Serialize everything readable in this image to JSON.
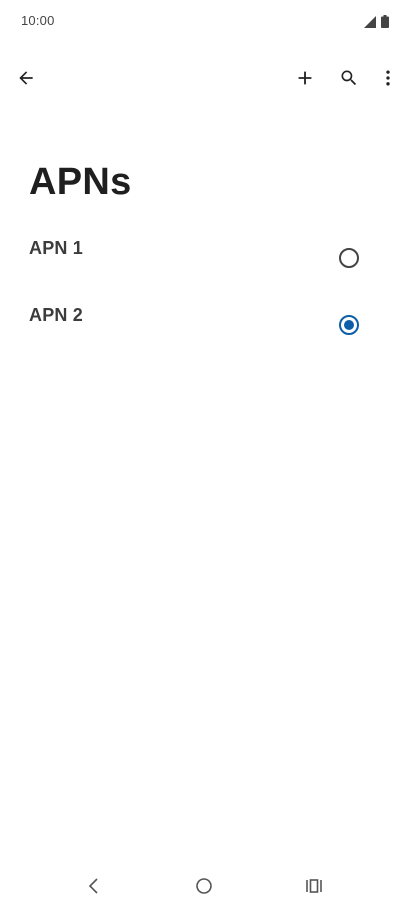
{
  "status_bar": {
    "time": "10:00",
    "icons": [
      "signal-icon",
      "battery-icon"
    ]
  },
  "app_bar": {
    "actions": [
      "back-arrow-icon",
      "add-icon",
      "search-icon",
      "more-vert-icon"
    ]
  },
  "page": {
    "title": "APNs"
  },
  "apns": [
    {
      "label": "APN 1",
      "selected": false
    },
    {
      "label": "APN 2",
      "selected": true
    }
  ],
  "nav_bar": {
    "buttons": [
      "nav-back-icon",
      "nav-home-icon",
      "nav-recents-icon"
    ]
  },
  "colors": {
    "accent": "#0d5ea8",
    "text": "#222222",
    "background": "#ffffff"
  }
}
